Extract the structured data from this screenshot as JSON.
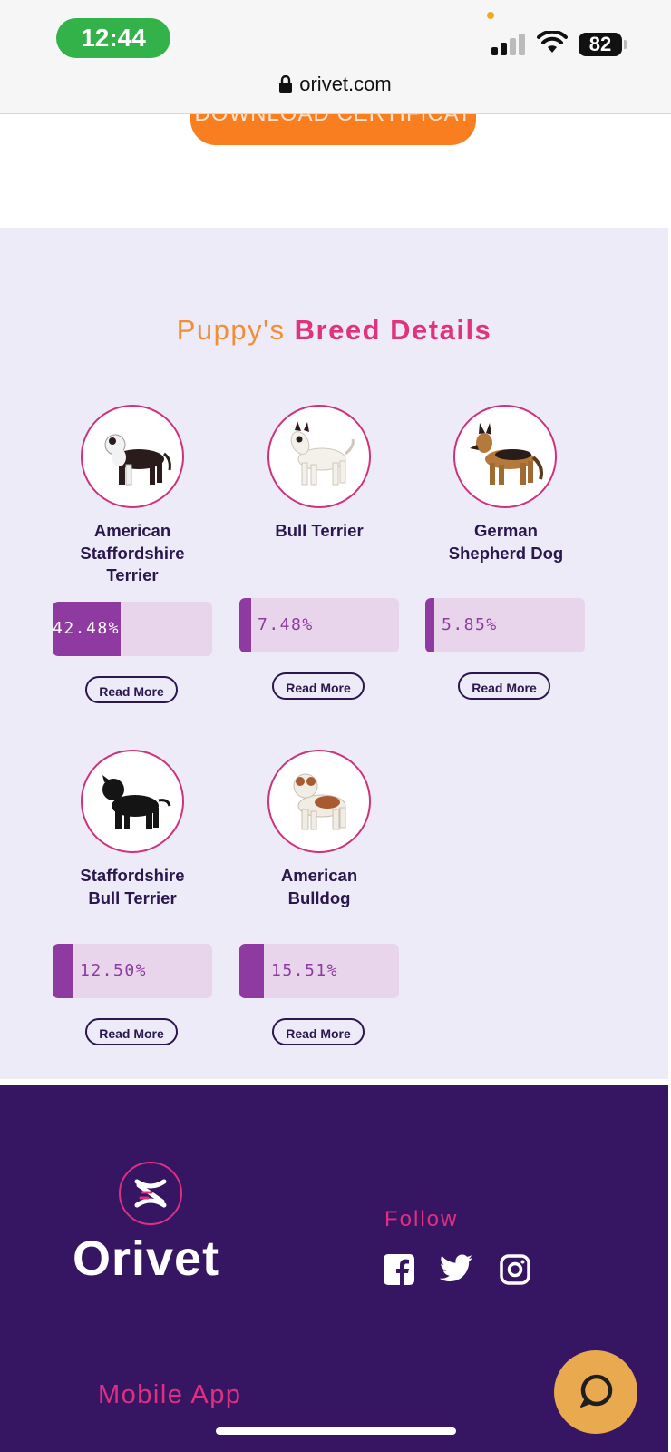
{
  "status_bar": {
    "time": "12:44",
    "battery": "82",
    "url": "orivet.com"
  },
  "download_button": {
    "label": "DOWNLOAD CERTIFICAT"
  },
  "breed_section": {
    "title_part1": "Puppy's",
    "title_part2": "Breed Details",
    "breeds": [
      {
        "name_line1": "American",
        "name_line2": "Staffordshire",
        "name_line3": "Terrier",
        "percent_label": "42.48%",
        "percent": 42.48,
        "read_more": "Read More"
      },
      {
        "name_line1": "Bull Terrier",
        "name_line2": "",
        "name_line3": "",
        "percent_label": "7.48%",
        "percent": 7.48,
        "read_more": "Read More"
      },
      {
        "name_line1": "German",
        "name_line2": "Shepherd Dog",
        "name_line3": "",
        "percent_label": "5.85%",
        "percent": 5.85,
        "read_more": "Read More"
      },
      {
        "name_line1": "Staffordshire",
        "name_line2": "Bull Terrier",
        "name_line3": "",
        "percent_label": "12.50%",
        "percent": 12.5,
        "read_more": "Read More"
      },
      {
        "name_line1": "American",
        "name_line2": "Bulldog",
        "name_line3": "",
        "percent_label": "15.51%",
        "percent": 15.51,
        "read_more": "Read More"
      }
    ]
  },
  "footer": {
    "logo_text": "Orivet",
    "follow_label": "Follow",
    "social_icons": [
      "facebook-icon",
      "twitter-icon",
      "instagram-icon"
    ],
    "mobile_app_label": "Mobile App"
  },
  "colors": {
    "accent_pink": "#df2f82",
    "accent_orange": "#f97e1f",
    "bar_fill": "#8e3aa0",
    "footer_bg": "#361563",
    "section_bg": "#edebf7"
  }
}
